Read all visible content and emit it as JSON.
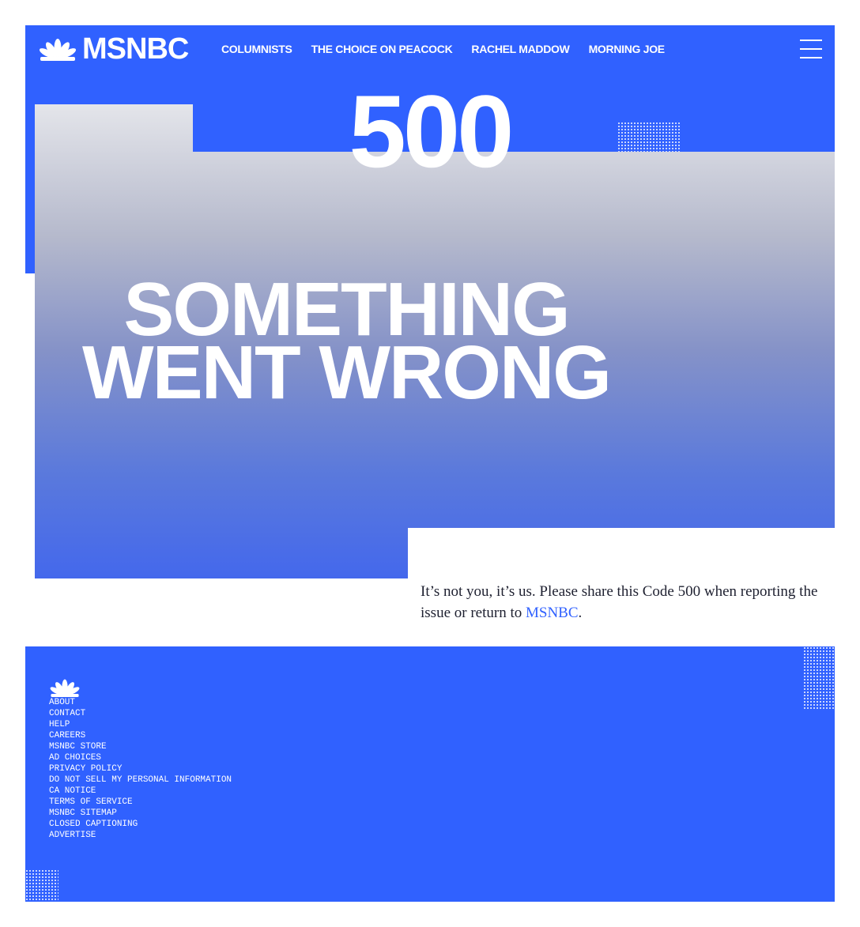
{
  "header": {
    "logo_text": "MSNBC",
    "nav": [
      "COLUMNISTS",
      "THE CHOICE ON PEACOCK",
      "RACHEL MADDOW",
      "MORNING JOE"
    ],
    "menu_icon": "hamburger-menu-icon"
  },
  "error": {
    "code": "500",
    "headline_line1": "SOMETHING",
    "headline_line2": "WENT WRONG",
    "message_before": "It’s not you, it’s us. Please share this Code 500 when reporting the issue or return to ",
    "message_link": "MSNBC",
    "message_after": "."
  },
  "footer": {
    "links": [
      "ABOUT",
      "CONTACT",
      "HELP",
      "CAREERS",
      "MSNBC STORE",
      "AD CHOICES",
      "PRIVACY POLICY",
      "DO NOT SELL MY PERSONAL INFORMATION",
      "CA NOTICE",
      "TERMS OF SERVICE",
      "MSNBC SITEMAP",
      "CLOSED CAPTIONING",
      "ADVERTISE"
    ]
  },
  "colors": {
    "brand_blue": "#3061ff",
    "text_dark": "#1e2030"
  }
}
